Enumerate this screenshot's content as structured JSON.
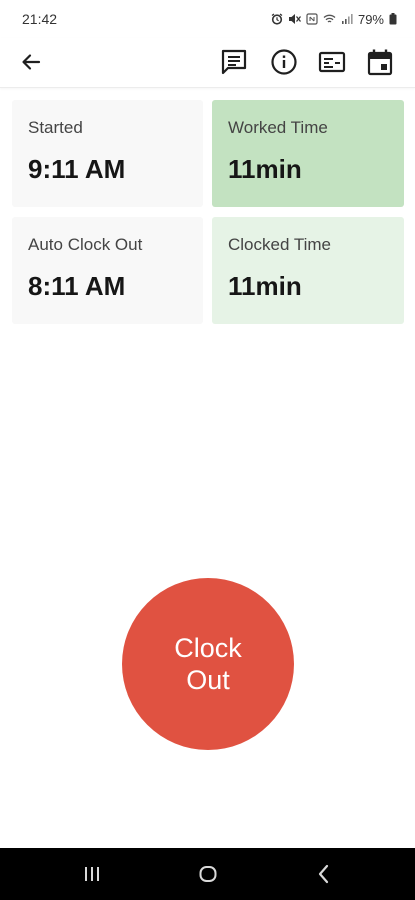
{
  "status_bar": {
    "time": "21:42",
    "battery_percent": "79%",
    "icons": [
      "alarm-icon",
      "mute-icon",
      "nfc-icon",
      "wifi-icon",
      "signal-icon",
      "battery-icon"
    ]
  },
  "app_bar": {
    "icons": [
      "back-arrow-icon",
      "notes-icon",
      "info-icon",
      "card-icon",
      "calendar-icon"
    ]
  },
  "tiles": [
    {
      "label": "Started",
      "value": "9:11 AM",
      "color": "#f8f8f8"
    },
    {
      "label": "Worked Time",
      "value": "11min",
      "color": "#c3e2c1"
    },
    {
      "label": "Auto Clock Out",
      "value": "8:11 AM",
      "color": "#f8f8f8"
    },
    {
      "label": "Clocked Time",
      "value": "11min",
      "color": "#e6f3e6"
    }
  ],
  "clock_button": {
    "label": "Clock\nOut",
    "color": "#e05241"
  },
  "nav_bar": {
    "icons": [
      "recents-icon",
      "home-icon",
      "back-icon"
    ]
  }
}
